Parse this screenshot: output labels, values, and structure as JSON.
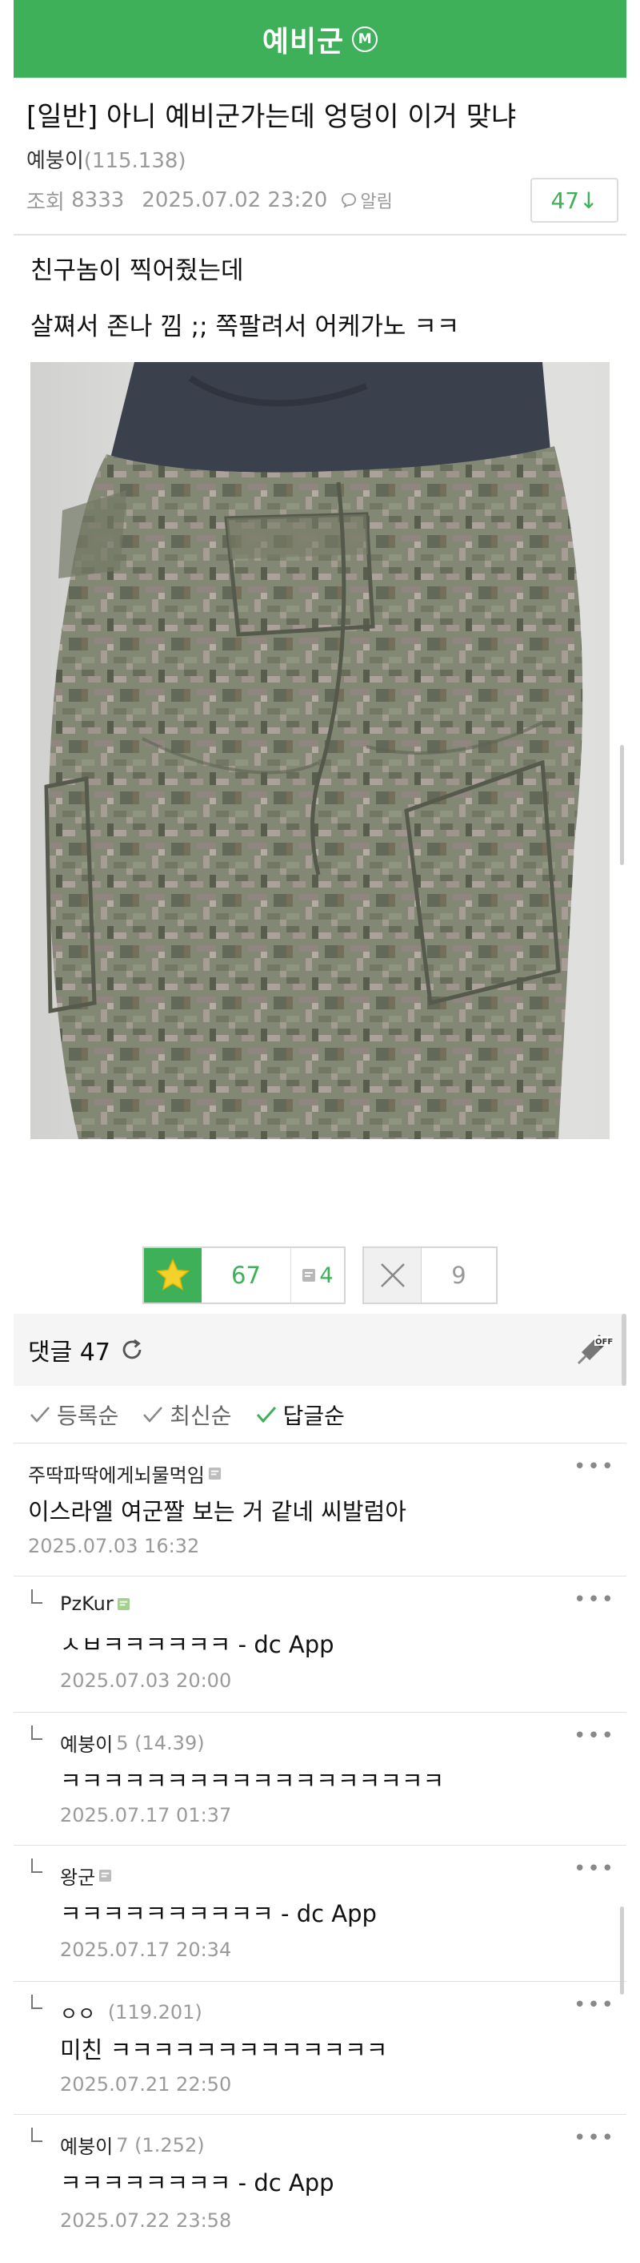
{
  "gallery": {
    "title": "예비군",
    "badge": "M"
  },
  "post": {
    "title": "[일반] 아니 예비군가는데 엉덩이 이거 맞냐",
    "author": "예붕이",
    "author_ip": "(115.138)",
    "views_label": "조회",
    "views": "8333",
    "datetime": "2025.07.02 23:20",
    "alarm_label": "알림",
    "comment_count_button": "47↓",
    "body_lines": [
      "친구놈이 찍어줬는데",
      "살쪄서 존나 낌 ;; 쪽팔려서 어케가노 ㅋㅋ"
    ]
  },
  "votes": {
    "up": "67",
    "fixed": "4",
    "down": "9"
  },
  "comments_header": {
    "label": "댓글 47"
  },
  "sort_options": [
    "등록순",
    "최신순",
    "답글순"
  ],
  "comments": [
    {
      "nick": "주딱파딱에게뇌물먹임",
      "ip": "",
      "text": "이스라엘 여군짤 보는 거 같네 씨발럼아",
      "date": "2025.07.03 16:32"
    },
    {
      "nick": "PzKur",
      "ip": "",
      "text": "ㅅㅂㅋㅋㅋㅋㅋㅋ - dc App",
      "date": "2025.07.03 20:00"
    },
    {
      "nick": "예붕이",
      "ip": "5 (14.39)",
      "text": "ㅋㅋㅋㅋㅋㅋㅋㅋㅋㅋㅋㅋㅋㅋㅋㅋㅋㅋ",
      "date": "2025.07.17 01:37"
    },
    {
      "nick": "왕군",
      "ip": "",
      "text": "ㅋㅋㅋㅋㅋㅋㅋㅋㅋㅋ - dc App",
      "date": "2025.07.17 20:34"
    },
    {
      "nick": "ㅇㅇ",
      "ip": "(119.201)",
      "text": "미친 ㅋㅋㅋㅋㅋㅋㅋㅋㅋㅋㅋㅋㅋ",
      "date": "2025.07.21 22:50"
    },
    {
      "nick": "예붕이",
      "ip": "7 (1.252)",
      "text": "ㅋㅋㅋㅋㅋㅋㅋㅋ - dc App",
      "date": "2025.07.22 23:58"
    }
  ],
  "colors": {
    "brand_green": "#3eb05a",
    "muted": "#9a9a9a"
  }
}
